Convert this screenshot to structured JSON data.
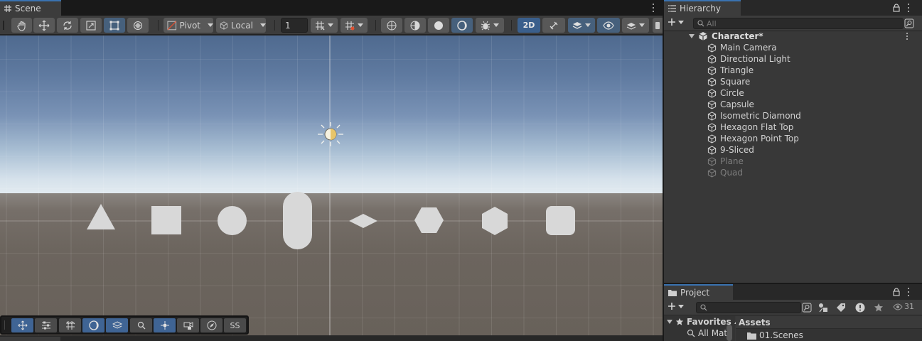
{
  "scene": {
    "tab_label": "Scene",
    "toolbar": {
      "pivot_label": "Pivot",
      "local_label": "Local",
      "grid_snap_value": "1",
      "twod_label": "2D"
    },
    "overlay": {
      "ss_label": "SS"
    }
  },
  "hierarchy": {
    "tab_label": "Hierarchy",
    "search_placeholder": "All",
    "root": "Character*",
    "items": [
      {
        "label": "Main Camera"
      },
      {
        "label": "Directional Light"
      },
      {
        "label": "Triangle"
      },
      {
        "label": "Square"
      },
      {
        "label": "Circle"
      },
      {
        "label": "Capsule"
      },
      {
        "label": "Isometric Diamond"
      },
      {
        "label": "Hexagon Flat Top"
      },
      {
        "label": "Hexagon Point Top"
      },
      {
        "label": "9-Sliced"
      },
      {
        "label": "Plane"
      },
      {
        "label": "Quad"
      }
    ]
  },
  "project": {
    "tab_label": "Project",
    "hidden_count": "31",
    "favorites_label": "Favorites",
    "all_materials_label": "All Mat",
    "assets_label": "Assets",
    "scenes_folder": "01.Scenes"
  },
  "colors": {
    "accent": "#3a72b0",
    "active_button": "#46607c",
    "panel_bg": "#383838",
    "shape_fill": "#d8d8d8"
  }
}
